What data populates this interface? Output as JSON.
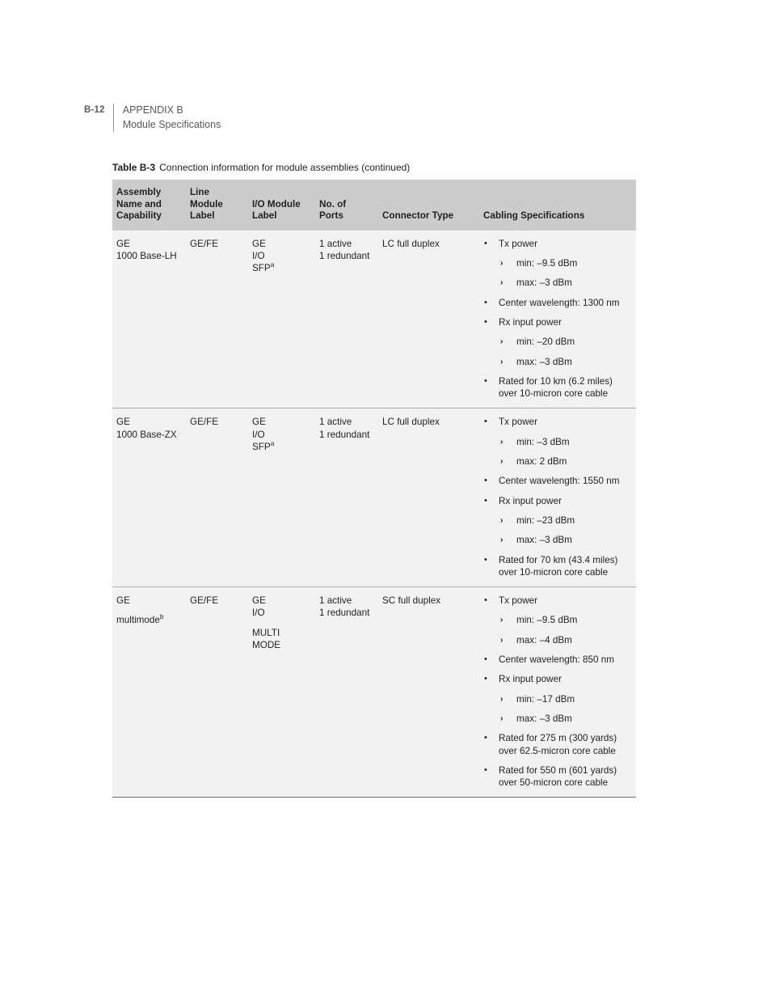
{
  "page_header": {
    "page_number": "B-12",
    "line1": "APPENDIX B",
    "line2": "Module Specifications"
  },
  "table_caption": {
    "label": "Table B-3",
    "text": "Connection information for module assemblies (continued)"
  },
  "table": {
    "columns": [
      {
        "id": "assembly",
        "header_lines": [
          "Assembly",
          "Name and",
          "Capability"
        ]
      },
      {
        "id": "line_module_label",
        "header_lines": [
          "Line",
          "Module",
          "Label"
        ]
      },
      {
        "id": "io_module_label",
        "header_lines": [
          "I/O Module",
          "Label"
        ]
      },
      {
        "id": "no_of_ports",
        "header_lines": [
          "No. of",
          "Ports"
        ]
      },
      {
        "id": "connector_type",
        "header_lines": [
          "Connector Type"
        ]
      },
      {
        "id": "cabling_specs",
        "header_lines": [
          "Cabling Specifications"
        ]
      }
    ],
    "rows": [
      {
        "assembly": {
          "lines": [
            "GE",
            "1000 Base-LH"
          ],
          "sup": null
        },
        "line_module_label": {
          "lines": [
            "GE/FE"
          ]
        },
        "io_module_label": {
          "lines": [
            "GE",
            "I/O",
            "SFP"
          ],
          "sup": "a",
          "sup_on_line": 2
        },
        "no_of_ports": {
          "lines": [
            "1 active",
            "1 redundant"
          ]
        },
        "connector_type": {
          "lines": [
            "LC full duplex"
          ]
        },
        "cabling_specs": [
          {
            "text": "Tx power",
            "sub": [
              {
                "text": "min: –9.5 dBm"
              },
              {
                "text": "max: –3 dBm"
              }
            ]
          },
          {
            "text": "Center wavelength: 1300 nm"
          },
          {
            "text": "Rx input power",
            "sub": [
              {
                "text": "min: –20 dBm"
              },
              {
                "text": "max: –3 dBm"
              }
            ]
          },
          {
            "lines": [
              "Rated for 10 km (6.2 miles)",
              "over 10-micron core cable"
            ]
          }
        ]
      },
      {
        "assembly": {
          "lines": [
            "GE",
            "1000 Base-ZX"
          ],
          "sup": null
        },
        "line_module_label": {
          "lines": [
            "GE/FE"
          ]
        },
        "io_module_label": {
          "lines": [
            "GE",
            "I/O",
            "SFP"
          ],
          "sup": "a",
          "sup_on_line": 2
        },
        "no_of_ports": {
          "lines": [
            "1 active",
            "1 redundant"
          ]
        },
        "connector_type": {
          "lines": [
            "LC full duplex"
          ]
        },
        "cabling_specs": [
          {
            "text": "Tx power",
            "sub": [
              {
                "text": "min: –3 dBm"
              },
              {
                "text": "max: 2 dBm"
              }
            ]
          },
          {
            "text": "Center wavelength: 1550 nm"
          },
          {
            "text": "Rx input power",
            "sub": [
              {
                "text": "min: –23 dBm"
              },
              {
                "text": "max: –3 dBm"
              }
            ]
          },
          {
            "lines": [
              "Rated for 70 km (43.4 miles)",
              "over 10-micron core cable"
            ]
          }
        ]
      },
      {
        "assembly": {
          "lines": [
            "GE",
            "multimode"
          ],
          "sup": "b",
          "sup_on_line": 1,
          "gap_before_line": 1
        },
        "line_module_label": {
          "lines": [
            "GE/FE"
          ]
        },
        "io_module_label": {
          "lines": [
            "GE",
            "I/O",
            "MULTI",
            "MODE"
          ],
          "gap_before_line": 2
        },
        "no_of_ports": {
          "lines": [
            "1 active",
            "1 redundant"
          ]
        },
        "connector_type": {
          "lines": [
            "SC full duplex"
          ]
        },
        "cabling_specs": [
          {
            "text": "Tx power",
            "sub": [
              {
                "text": "min: –9.5 dBm"
              },
              {
                "text": "max: –4 dBm"
              }
            ]
          },
          {
            "text": "Center wavelength: 850 nm"
          },
          {
            "text": "Rx input power",
            "sub": [
              {
                "text": "min: –17 dBm"
              },
              {
                "text": "max: –3 dBm"
              }
            ]
          },
          {
            "lines": [
              "Rated for 275 m (300 yards)",
              "over 62.5-micron core cable"
            ]
          },
          {
            "lines": [
              "Rated for 550 m (601 yards)",
              "over 50-micron core cable"
            ]
          }
        ]
      }
    ]
  },
  "glyphs": {
    "bullet": "•",
    "sub_bullet": "›"
  },
  "colors": {
    "header_bg": "#cccccc",
    "row_bg": "#f2f2f2",
    "text": "#231f20",
    "rule": "#a7a9ac",
    "bottom_rule": "#6d6e71",
    "running_header": "#58595b"
  }
}
